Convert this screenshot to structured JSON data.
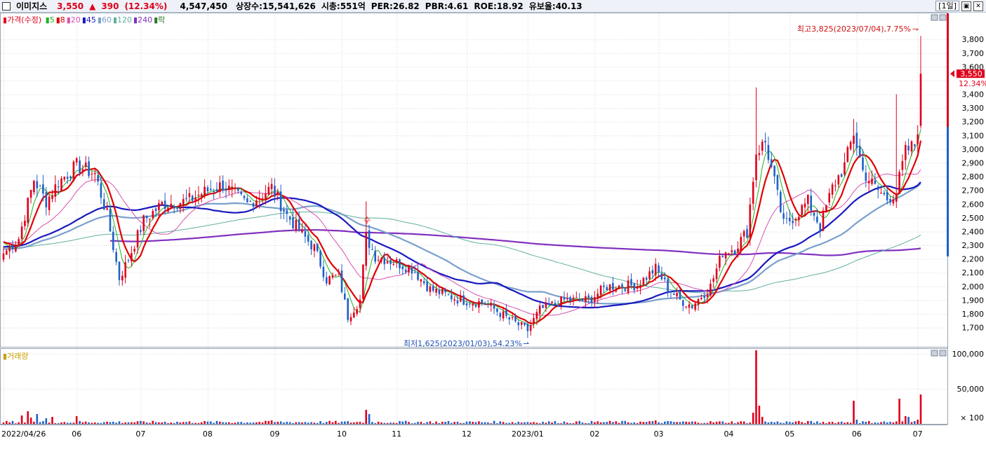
{
  "header": {
    "stock_name": "이미지스",
    "price": "3,550",
    "change_arrow": "▲",
    "change": "390",
    "change_pct": "(12.34%)",
    "volume": "4,547,450",
    "listed_shares": "상장수:15,541,626",
    "market_cap": "시총:551억",
    "per": "PER:26.82",
    "pbr": "PBR:4.61",
    "roe": "ROE:18.92",
    "float_ratio": "유보율:40.13",
    "period": "[1일]",
    "minimize_label": "▣",
    "close_label": "✕"
  },
  "colors": {
    "up": "#e0001b",
    "down": "#2060c8",
    "ma5": "#22b122",
    "ma8": "#e00000",
    "ma20": "#d850b0",
    "ma45": "#1818c0",
    "ma60": "#7aa0cc",
    "ma120": "#60b0a0",
    "ma240": "#8030c0",
    "grid": "#d8d8d8"
  },
  "price_legend": {
    "label": "가격(수정)",
    "items": [
      {
        "label": "5",
        "color": "#22b122"
      },
      {
        "label": "8",
        "color": "#e00000"
      },
      {
        "label": "20",
        "color": "#d850b0"
      },
      {
        "label": "45",
        "color": "#1818c0"
      },
      {
        "label": "60",
        "color": "#7aa0cc"
      },
      {
        "label": "120",
        "color": "#60b0a0"
      },
      {
        "label": "240",
        "color": "#8030c0"
      },
      {
        "label": "락",
        "color": "#2a7a2a"
      }
    ]
  },
  "volume_legend": {
    "label": "거래량"
  },
  "chart_data": [
    {
      "type": "candlestick",
      "title": "",
      "y_ticks": [
        1700,
        1800,
        1900,
        2000,
        2100,
        2200,
        2300,
        2400,
        2500,
        2600,
        2700,
        2800,
        2900,
        3000,
        3100,
        3200,
        3300,
        3400,
        3500,
        3600,
        3700,
        3800
      ],
      "y_tick_labels": [
        "1,700",
        "1,800",
        "1,900",
        "2,000",
        "2,100",
        "2,200",
        "2,300",
        "2,400",
        "2,500",
        "2,600",
        "2,700",
        "2,800",
        "2,900",
        "3,000",
        "3,100",
        "3,200",
        "3,300",
        "3,400",
        "3,500",
        "3,600",
        "3,700",
        "3,800"
      ],
      "ylim": [
        1560,
        3990
      ],
      "x_tick_labels": [
        "2022/04/26",
        "06",
        "07",
        "08",
        "09",
        "10",
        "11",
        "12",
        "2023/01",
        "02",
        "03",
        "04",
        "05",
        "06",
        "07"
      ],
      "x_tick_index": [
        0,
        24,
        45,
        67,
        89,
        111,
        129,
        152,
        172,
        194,
        215,
        238,
        258,
        280,
        300
      ],
      "n_days": 302,
      "last_price": 3550,
      "last_price_label": "3,550",
      "last_change_label": "12.34%",
      "high_annotation": "최고3,825(2023/07/04),7.75%",
      "low_annotation": "최저1,625(2023/01/03),54.23%",
      "high_value": 3825,
      "low_value": 1625,
      "signal_marker": "수",
      "key_closes": [
        {
          "i": 0,
          "v": 2240
        },
        {
          "i": 5,
          "v": 2350
        },
        {
          "i": 10,
          "v": 2780
        },
        {
          "i": 14,
          "v": 2620
        },
        {
          "i": 18,
          "v": 2760
        },
        {
          "i": 24,
          "v": 2880
        },
        {
          "i": 30,
          "v": 2820
        },
        {
          "i": 34,
          "v": 2520
        },
        {
          "i": 38,
          "v": 2060
        },
        {
          "i": 41,
          "v": 2200
        },
        {
          "i": 46,
          "v": 2480
        },
        {
          "i": 52,
          "v": 2600
        },
        {
          "i": 60,
          "v": 2620
        },
        {
          "i": 66,
          "v": 2690
        },
        {
          "i": 72,
          "v": 2740
        },
        {
          "i": 80,
          "v": 2600
        },
        {
          "i": 88,
          "v": 2720
        },
        {
          "i": 93,
          "v": 2520
        },
        {
          "i": 98,
          "v": 2380
        },
        {
          "i": 102,
          "v": 2280
        },
        {
          "i": 106,
          "v": 2050
        },
        {
          "i": 110,
          "v": 2080
        },
        {
          "i": 113,
          "v": 1780
        },
        {
          "i": 117,
          "v": 1900
        },
        {
          "i": 119,
          "v": 2360
        },
        {
          "i": 122,
          "v": 2220
        },
        {
          "i": 128,
          "v": 2180
        },
        {
          "i": 134,
          "v": 2130
        },
        {
          "i": 140,
          "v": 1980
        },
        {
          "i": 150,
          "v": 1900
        },
        {
          "i": 158,
          "v": 1880
        },
        {
          "i": 166,
          "v": 1760
        },
        {
          "i": 172,
          "v": 1680
        },
        {
          "i": 176,
          "v": 1830
        },
        {
          "i": 184,
          "v": 1900
        },
        {
          "i": 192,
          "v": 1900
        },
        {
          "i": 198,
          "v": 2000
        },
        {
          "i": 208,
          "v": 2010
        },
        {
          "i": 214,
          "v": 2130
        },
        {
          "i": 218,
          "v": 1990
        },
        {
          "i": 222,
          "v": 1900
        },
        {
          "i": 226,
          "v": 1860
        },
        {
          "i": 232,
          "v": 2000
        },
        {
          "i": 236,
          "v": 2250
        },
        {
          "i": 240,
          "v": 2280
        },
        {
          "i": 244,
          "v": 2400
        },
        {
          "i": 247,
          "v": 2980
        },
        {
          "i": 250,
          "v": 3050
        },
        {
          "i": 253,
          "v": 2760
        },
        {
          "i": 256,
          "v": 2450
        },
        {
          "i": 260,
          "v": 2520
        },
        {
          "i": 264,
          "v": 2620
        },
        {
          "i": 268,
          "v": 2440
        },
        {
          "i": 272,
          "v": 2720
        },
        {
          "i": 276,
          "v": 2880
        },
        {
          "i": 279,
          "v": 3120
        },
        {
          "i": 282,
          "v": 2840
        },
        {
          "i": 286,
          "v": 2720
        },
        {
          "i": 290,
          "v": 2640
        },
        {
          "i": 293,
          "v": 2690
        },
        {
          "i": 296,
          "v": 2980
        },
        {
          "i": 299,
          "v": 3030
        },
        {
          "i": 300,
          "v": 3160
        },
        {
          "i": 301,
          "v": 3550
        }
      ],
      "ma_periods": [
        5,
        8,
        20,
        45,
        60,
        120,
        240
      ]
    },
    {
      "type": "bar",
      "title": "거래량",
      "y_ticks": [
        50000,
        100000
      ],
      "y_tick_labels": [
        "50,000",
        "100,000"
      ],
      "ylim": [
        0,
        107000
      ],
      "unit_label": "× 100",
      "volume_spikes": [
        {
          "i": 6,
          "v": 12000
        },
        {
          "i": 8,
          "v": 18000
        },
        {
          "i": 9,
          "v": 9000
        },
        {
          "i": 11,
          "v": 14000
        },
        {
          "i": 14,
          "v": 8000
        },
        {
          "i": 16,
          "v": 10000
        },
        {
          "i": 24,
          "v": 11000
        },
        {
          "i": 88,
          "v": 5000
        },
        {
          "i": 119,
          "v": 20000
        },
        {
          "i": 120,
          "v": 14000
        },
        {
          "i": 214,
          "v": 5000
        },
        {
          "i": 246,
          "v": 16000
        },
        {
          "i": 247,
          "v": 105000
        },
        {
          "i": 248,
          "v": 26000
        },
        {
          "i": 249,
          "v": 10000
        },
        {
          "i": 279,
          "v": 33000
        },
        {
          "i": 280,
          "v": 6000
        },
        {
          "i": 294,
          "v": 36000
        },
        {
          "i": 296,
          "v": 11000
        },
        {
          "i": 297,
          "v": 10000
        },
        {
          "i": 300,
          "v": 6000
        },
        {
          "i": 301,
          "v": 42000
        }
      ]
    }
  ]
}
